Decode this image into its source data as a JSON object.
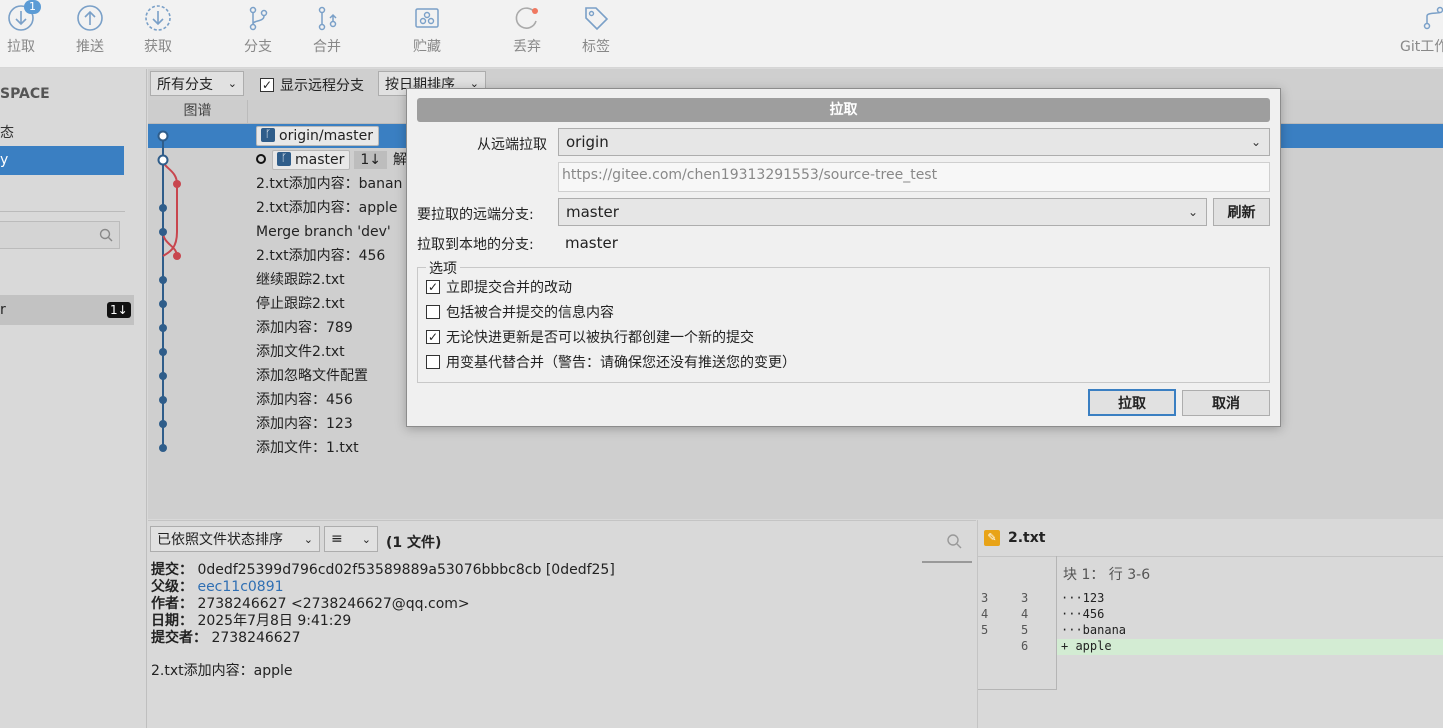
{
  "toolbar": {
    "pull": {
      "label": "拉取",
      "badge": "1"
    },
    "push": {
      "label": "推送"
    },
    "fetch": {
      "label": "获取"
    },
    "branch": {
      "label": "分支"
    },
    "merge": {
      "label": "合并"
    },
    "stash": {
      "label": "贮藏"
    },
    "discard": {
      "label": "丢弃"
    },
    "tag": {
      "label": "标签"
    },
    "gitflow": {
      "label": "Git工作"
    }
  },
  "sidebar": {
    "workspace": "SPACE",
    "status": "态",
    "selected": "y",
    "remote_item": "r",
    "remote_badge": "1↓"
  },
  "graph_toolbar": {
    "branches_filter": "所有分支",
    "show_remote": "显示远程分支",
    "sort": "按日期排序"
  },
  "graph": {
    "column_header": "图谱",
    "commits": [
      {
        "refs": [
          "origin/master"
        ],
        "message": ""
      },
      {
        "refs": [
          "master"
        ],
        "ahead_behind": "1↓",
        "message": "解"
      },
      {
        "refs": [],
        "message": "2.txt添加内容：banan"
      },
      {
        "refs": [],
        "message": "2.txt添加内容：apple"
      },
      {
        "refs": [],
        "message": "Merge branch 'dev'"
      },
      {
        "refs": [],
        "message": "2.txt添加内容：456"
      },
      {
        "refs": [],
        "message": "继续跟踪2.txt"
      },
      {
        "refs": [],
        "message": "停止跟踪2.txt"
      },
      {
        "refs": [],
        "message": "添加内容：789"
      },
      {
        "refs": [],
        "message": "添加文件2.txt"
      },
      {
        "refs": [],
        "message": "添加忽略文件配置"
      },
      {
        "refs": [],
        "message": "添加内容：456"
      },
      {
        "refs": [],
        "message": "添加内容：123"
      },
      {
        "refs": [],
        "message": "添加文件：1.txt"
      }
    ]
  },
  "details": {
    "sort_label": "已依照文件状态排序",
    "list_icon": "≡",
    "file_count": "(1 文件)",
    "commit_label": "提交：",
    "commit_value": "0dedf25399d796cd02f53589889a53076bbbc8cb [0dedf25]",
    "parent_label": "父级：",
    "parent_value": "eec11c0891",
    "author_label": "作者：",
    "author_value": "2738246627 <2738246627@qq.com>",
    "date_label": "日期：",
    "date_value": "2025年7月8日 9:41:29",
    "committer_label": "提交者：",
    "committer_value": "2738246627",
    "message": "2.txt添加内容：apple"
  },
  "diff": {
    "file_name": "2.txt",
    "hunk_header": "块 1： 行 3-6",
    "lines": [
      {
        "old": "3",
        "new": "3",
        "text": "···123"
      },
      {
        "old": "4",
        "new": "4",
        "text": "···456"
      },
      {
        "old": "5",
        "new": "5",
        "text": "···banana"
      },
      {
        "old": "",
        "new": "6",
        "text": "+ apple"
      }
    ]
  },
  "dialog": {
    "title": "拉取",
    "remote_label": "从远端拉取",
    "remote_value": "origin",
    "remote_url": "https://gitee.com/chen19313291553/source-tree_test",
    "remote_branch_label": "要拉取的远端分支:",
    "remote_branch_value": "master",
    "refresh": "刷新",
    "local_branch_label": "拉取到本地的分支:",
    "local_branch_value": "master",
    "options_title": "选项",
    "options": [
      {
        "label": "立即提交合并的改动",
        "checked": true
      },
      {
        "label": "包括被合并提交的信息内容",
        "checked": false
      },
      {
        "label": "无论快进更新是否可以被执行都创建一个新的提交",
        "checked": true
      },
      {
        "label": "用变基代替合并（警告：请确保您还没有推送您的变更）",
        "checked": false
      }
    ],
    "ok": "拉取",
    "cancel": "取消"
  },
  "colors": {
    "accent": "#5b9bd5",
    "selected_row": "#3a7fc2",
    "graph_line": "#2f5d8a",
    "branch_line": "#c8464e",
    "added_line": "#d3ecd3"
  }
}
